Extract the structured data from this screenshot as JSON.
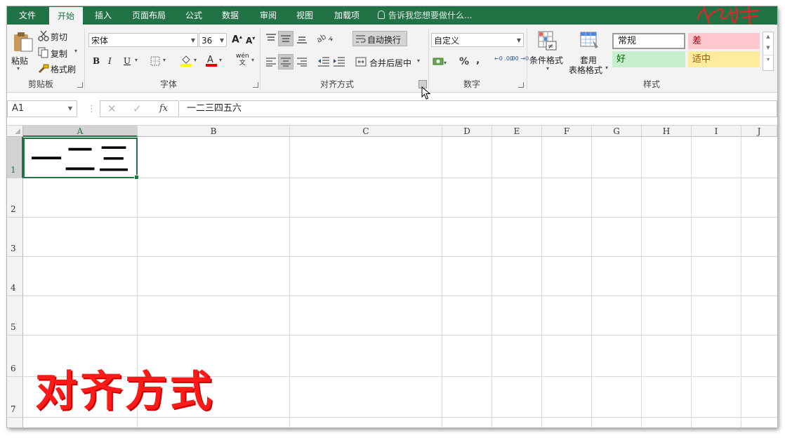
{
  "menu": {
    "tabs": [
      "文件",
      "开始",
      "插入",
      "页面布局",
      "公式",
      "数据",
      "审阅",
      "视图",
      "加载项"
    ],
    "active_tab": "开始",
    "tell_me": "告诉我您想要做什么..."
  },
  "ribbon": {
    "clipboard": {
      "paste": "粘贴",
      "cut": "剪切",
      "copy": "复制",
      "format_painter": "格式刷",
      "label": "剪贴板"
    },
    "font": {
      "name": "宋体",
      "size": "36",
      "bold": "B",
      "italic": "I",
      "underline": "U",
      "label": "字体",
      "grow": "A",
      "shrink": "A",
      "phonetic_top": "wén",
      "phonetic_bottom": "文"
    },
    "alignment": {
      "wrap_text": "自动换行",
      "merge_center": "合并后居中",
      "label": "对齐方式"
    },
    "number": {
      "format": "自定义",
      "percent": "%",
      "comma": ",",
      "inc_decimal": "←0 .00",
      "dec_decimal": ".00 →0",
      "label": "数字"
    },
    "styles": {
      "conditional_format": "条件格式",
      "table_format_line1": "套用",
      "table_format_line2": "表格格式",
      "normal": "常规",
      "bad": "差",
      "good": "好",
      "neutral": "适中",
      "label": "样式"
    }
  },
  "formula_bar": {
    "name_box": "A1",
    "fx": "fx",
    "content": "一二三四五六"
  },
  "grid": {
    "columns": [
      "A",
      "B",
      "C",
      "D",
      "E",
      "F",
      "G",
      "H",
      "I",
      "J"
    ],
    "rows": [
      "1",
      "2",
      "3",
      "4",
      "5",
      "6",
      "7"
    ],
    "selected_cell": "A1",
    "a1_display": "一二三"
  },
  "overlay_caption": "对齐方式",
  "colors": {
    "accent": "#217346",
    "bad_bg": "#ffc7ce",
    "bad_fg": "#9c0006",
    "good_bg": "#c6efce",
    "good_fg": "#006100",
    "neutral_bg": "#ffeb9c",
    "neutral_fg": "#9c5700",
    "caption": "#ff1a1a"
  }
}
